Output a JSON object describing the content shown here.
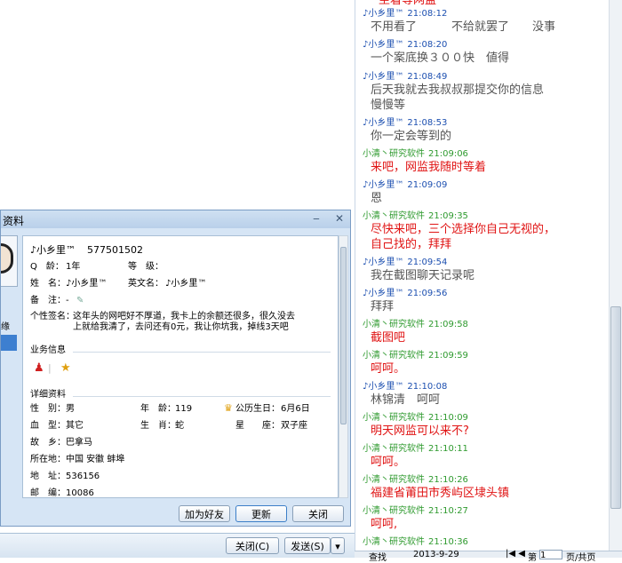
{
  "dialog": {
    "title": "资料",
    "minimize": "‒",
    "close": "✕",
    "side_char": "缘",
    "header_name": "♪小乡里™",
    "header_qq": "577501502",
    "fields": {
      "q_label": "Q　龄：",
      "q_value": "1年",
      "level_label": "等　级：",
      "name_label": "姓　名：",
      "name_value": "♪小乡里™",
      "en_name_label": "英文名：",
      "en_name_value": "♪小乡里™",
      "note_label": "备　注：",
      "note_value": "-",
      "sig_label": "个性签名：",
      "sig_line1": "这年头的网吧好不厚道，我卡上的余额还很多，很久没去",
      "sig_line2": "上就给我清了，去问还有0元，我让你坑我，掉线3天吧"
    },
    "section_service": "业务信息",
    "section_detail": "详细资料",
    "details": {
      "gender_label": "性　别：",
      "gender_value": "男",
      "age_label": "年　龄：",
      "age_value": "119",
      "birthday_label": "公历生日：",
      "birthday_value": "6月6日",
      "blood_label": "血　型：",
      "blood_value": "其它",
      "zodiac_label": "生　肖：",
      "zodiac_value": "蛇",
      "constellation_label": "星　　座：",
      "constellation_value": "双子座",
      "hometown_label": "故　乡：",
      "hometown_value": "巴拿马",
      "location_label": "所在地：",
      "location_value": "中国 安徽 蚌埠",
      "address_label": "地　址：",
      "address_value": "536156",
      "zip_label": "邮　编：",
      "zip_value": "10086"
    },
    "buttons": {
      "add_friend": "加为好友",
      "refresh": "更新",
      "close": "关闭"
    }
  },
  "left_bottom": {
    "close_btn": "关闭(C)",
    "send_btn": "发送(S)"
  },
  "chat": {
    "top_partial": "坐着等网监",
    "messages": [
      {
        "sender": "♪小乡里™",
        "time": "21:08:12",
        "sender_color": "blue",
        "text": "不用看了　　　不给就罢了　　没事",
        "text_color": "gray"
      },
      {
        "sender": "♪小乡里™",
        "time": "21:08:20",
        "sender_color": "blue",
        "text": "一个案底换３００快　値得",
        "text_color": "gray"
      },
      {
        "sender": "♪小乡里™",
        "time": "21:08:49",
        "sender_color": "blue",
        "text": "后天我就去我叔叔那提交你的信息\n慢慢等",
        "text_color": "gray"
      },
      {
        "sender": "♪小乡里™",
        "time": "21:08:53",
        "sender_color": "blue",
        "text": "你一定会等到的",
        "text_color": "gray"
      },
      {
        "sender": "小清丶研究软件",
        "time": "21:09:06",
        "sender_color": "green",
        "text": "来吧，网监我随时等着",
        "text_color": "red"
      },
      {
        "sender": "♪小乡里™",
        "time": "21:09:09",
        "sender_color": "blue",
        "text": "恩",
        "text_color": "gray"
      },
      {
        "sender": "小清丶研究软件",
        "time": "21:09:35",
        "sender_color": "green",
        "text": "尽快来吧，三个选择你自己无视的，\n自己找的，拜拜",
        "text_color": "red"
      },
      {
        "sender": "♪小乡里™",
        "time": "21:09:54",
        "sender_color": "blue",
        "text": "我在截图聊天记录呢",
        "text_color": "gray"
      },
      {
        "sender": "♪小乡里™",
        "time": "21:09:56",
        "sender_color": "blue",
        "text": "拜拜",
        "text_color": "gray"
      },
      {
        "sender": "小清丶研究软件",
        "time": "21:09:58",
        "sender_color": "green",
        "text": "截图吧",
        "text_color": "red"
      },
      {
        "sender": "小清丶研究软件",
        "time": "21:09:59",
        "sender_color": "green",
        "text": "呵呵。",
        "text_color": "red"
      },
      {
        "sender": "♪小乡里™",
        "time": "21:10:08",
        "sender_color": "blue",
        "text": "林锦清　呵呵",
        "text_color": "gray"
      },
      {
        "sender": "小清丶研究软件",
        "time": "21:10:09",
        "sender_color": "green",
        "text": "明天网监可以来不?",
        "text_color": "red"
      },
      {
        "sender": "小清丶研究软件",
        "time": "21:10:11",
        "sender_color": "green",
        "text": "呵呵。",
        "text_color": "red"
      },
      {
        "sender": "小清丶研究软件",
        "time": "21:10:26",
        "sender_color": "green",
        "text": "福建省莆田市秀屿区埭头镇",
        "text_color": "red"
      },
      {
        "sender": "小清丶研究软件",
        "time": "21:10:27",
        "sender_color": "green",
        "text": "呵呵,",
        "text_color": "red"
      },
      {
        "sender": "小清丶研究软件",
        "time": "21:10:36",
        "sender_color": "green",
        "text": "",
        "text_color": "red"
      }
    ]
  },
  "bottom_bar": {
    "find": "查找",
    "date": "2013-9-29",
    "page_prefix": "第",
    "page_value": "1",
    "page_suffix": "页/共页"
  }
}
